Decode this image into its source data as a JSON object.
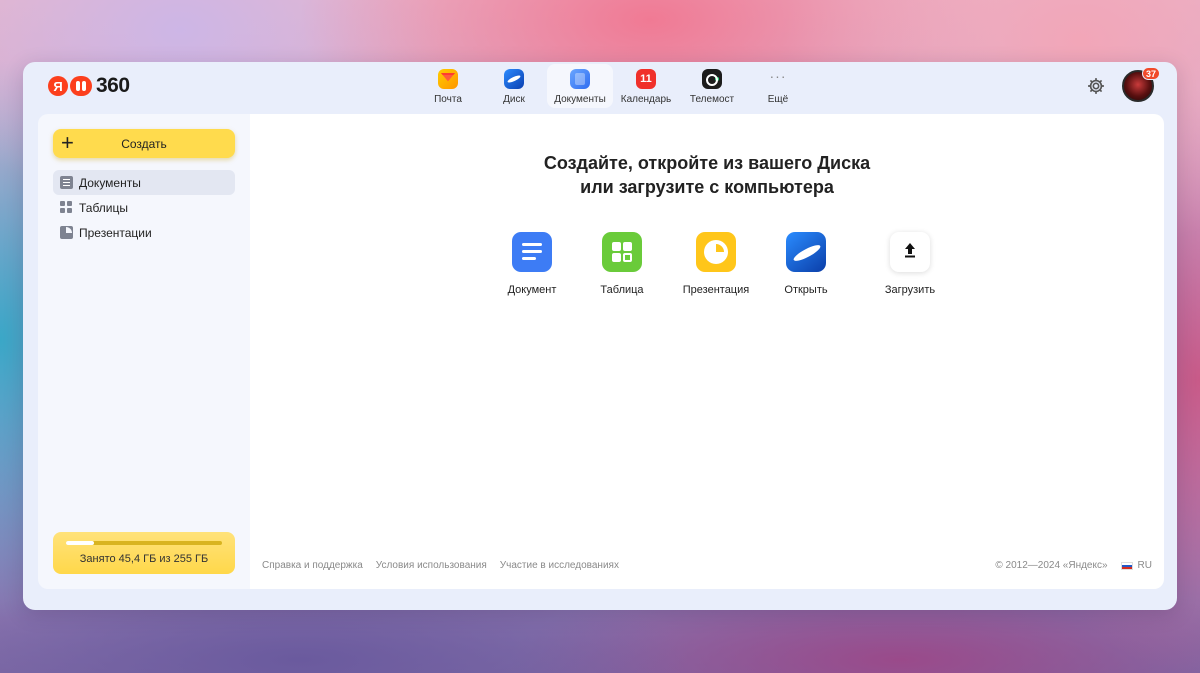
{
  "header": {
    "logo_letter": "Я",
    "logo_number": "360",
    "services": [
      {
        "label": "Почта",
        "icon": "mail-icon"
      },
      {
        "label": "Диск",
        "icon": "disk-icon"
      },
      {
        "label": "Документы",
        "icon": "documents-icon",
        "active": true
      },
      {
        "label": "Календарь",
        "icon": "calendar-icon",
        "icon_text": "11"
      },
      {
        "label": "Телемост",
        "icon": "telemost-icon"
      },
      {
        "label": "Ещё",
        "icon": "more-icon",
        "icon_text": "···"
      }
    ],
    "notifications_count": "37"
  },
  "sidebar": {
    "create_label": "Создать",
    "items": [
      {
        "label": "Документы",
        "icon": "document-icon",
        "active": true
      },
      {
        "label": "Таблицы",
        "icon": "table-icon"
      },
      {
        "label": "Презентации",
        "icon": "presentation-icon"
      }
    ],
    "storage": {
      "text": "Занято 45,4 ГБ из 255 ГБ",
      "used_fraction": 0.178
    }
  },
  "main": {
    "headline_line1": "Создайте, откройте из вашего Диска",
    "headline_line2": "или загрузите с компьютера",
    "actions": [
      {
        "label": "Документ",
        "icon": "document-tile-icon"
      },
      {
        "label": "Таблица",
        "icon": "table-tile-icon"
      },
      {
        "label": "Презентация",
        "icon": "presentation-tile-icon"
      },
      {
        "label": "Открыть",
        "icon": "disk-open-icon"
      },
      {
        "label": "Загрузить",
        "icon": "upload-icon"
      }
    ]
  },
  "footer": {
    "links": [
      "Справка и поддержка",
      "Условия использования",
      "Участие в исследованиях"
    ],
    "copyright": "© 2012—2024 «Яндекс»",
    "language": "RU"
  },
  "colors": {
    "accent_yellow": "#ffdb4d",
    "logo_red": "#fc3f1d",
    "doc_blue": "#3d7cf5",
    "table_green": "#6acb3a",
    "presentation_yellow": "#ffc61a"
  }
}
